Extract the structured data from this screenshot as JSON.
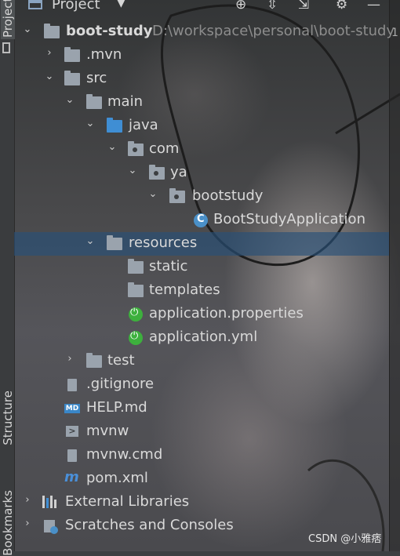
{
  "header": {
    "title": "Project"
  },
  "side": {
    "project": "Project",
    "structure": "Structure",
    "bookmarks": "Bookmarks"
  },
  "gutter_text": "1",
  "tree": {
    "root": {
      "label": "boot-study",
      "path": "D:\\workspace\\personal\\boot-study"
    },
    "mvn": "mvn",
    "src": "src",
    "main": "main",
    "java": "java",
    "com": "com",
    "ya": "ya",
    "bootstudy": "bootstudy",
    "app_class": "BootStudyApplication",
    "resources": "resources",
    "static": "static",
    "templates": "templates",
    "app_props": "application.properties",
    "app_yml": "application.yml",
    "test": "test",
    "gitignore": ".gitignore",
    "help": "HELP.md",
    "mvnw": "mvnw",
    "mvnw_cmd": "mvnw.cmd",
    "pom": "pom.xml",
    "ext_libs": "External Libraries",
    "scratches": "Scratches and Consoles"
  },
  "icon_labels": {
    "md_badge": "MD",
    "maven_glyph": "m"
  },
  "watermark": "CSDN @小雅痞",
  "colors": {
    "selection": "#28507a",
    "spring": "#3db03d",
    "folder_blue": "#3f8ed4",
    "folder_gray": "#9aa3ad"
  }
}
